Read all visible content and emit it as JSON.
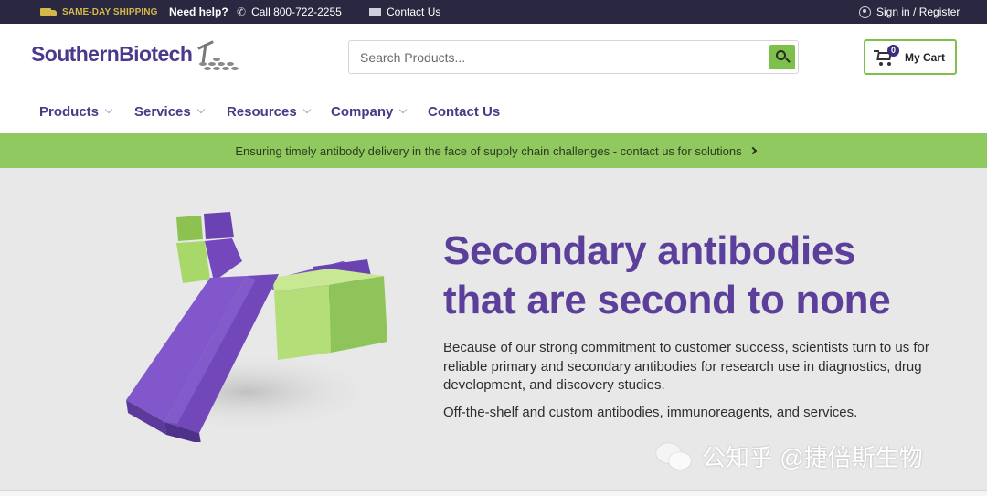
{
  "topbar": {
    "shipping": "SAME-DAY SHIPPING",
    "help": "Need help?",
    "call": "Call 800-722-2255",
    "contact": "Contact Us",
    "signin": "Sign in / Register"
  },
  "header": {
    "logo": "SouthernBiotech",
    "search_placeholder": "Search Products...",
    "cart_count": "0",
    "cart_label": "My Cart"
  },
  "nav": {
    "items": [
      {
        "label": "Products",
        "dropdown": true
      },
      {
        "label": "Services",
        "dropdown": true
      },
      {
        "label": "Resources",
        "dropdown": true
      },
      {
        "label": "Company",
        "dropdown": true
      },
      {
        "label": "Contact Us",
        "dropdown": false
      }
    ]
  },
  "announcement": {
    "text": "Ensuring timely antibody delivery in the face of supply chain challenges - contact us for solutions"
  },
  "hero": {
    "title_line1": "Secondary antibodies",
    "title_line2": "that are second to none",
    "body": "Because of our strong commitment to customer success, scientists turn to us for reliable primary and secondary antibodies for research use in diagnostics, drug development, and discovery studies.",
    "body2": "Off-the-shelf and custom antibodies, immunoreagents, and services."
  },
  "watermark": {
    "text": "公知乎 @捷倍斯生物"
  },
  "colors": {
    "topbar_bg": "#2a2740",
    "brand_purple": "#5b3f9a",
    "nav_purple": "#4a3a86",
    "accent_green": "#7dc04b",
    "announce_green": "#8fc960",
    "hero_bg": "#e8e8e8"
  },
  "icons": [
    "truck-icon",
    "phone-icon",
    "mail-icon",
    "user-icon",
    "search-icon",
    "cart-icon",
    "chevron-down-icon",
    "chevron-right-icon",
    "wechat-icon"
  ]
}
